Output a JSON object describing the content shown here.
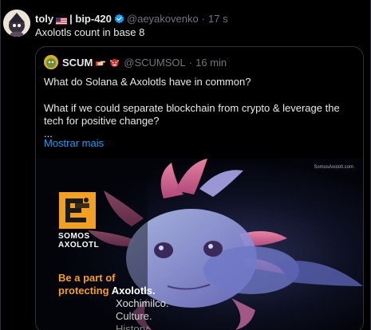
{
  "tweet": {
    "author_name": "toly",
    "author_suffix": "| bip-420",
    "handle": "@aeyakovenko",
    "separator": "·",
    "time": "17 s",
    "text": "Axolotls count in base 8"
  },
  "quote": {
    "author_name": "SCUM",
    "handle": "@SCUMSOL",
    "separator": "·",
    "time": "16 min",
    "line1": "What do Solana & Axolotls have in common?",
    "line2": "What if we could separate blockchain from crypto & leverage the tech for positive change?",
    "line3": "...",
    "show_more": "Mostrar mais"
  },
  "media": {
    "site": "SomosAxolotl.com",
    "logo_line1": "SOMOS",
    "logo_line2": "AXOLOTL",
    "cta_line1": "Be a part of",
    "cta_line2_orange": "protecting",
    "cta_line2_white": "Axolotls.",
    "cta_line3": "Xochimilco.",
    "cta_line4": "Culture.",
    "cta_line5": "History."
  },
  "colors": {
    "background": "#000000",
    "text": "#e7e9ea",
    "muted": "#71767b",
    "link": "#1d9bf0",
    "verified": "#1d9bf0",
    "brand_orange": "#f2a024"
  },
  "icons": [
    "avatar",
    "us-flag-icon",
    "verified-badge-icon",
    "pointing-hand-icon",
    "ogre-icon",
    "somos-axolotl-logo"
  ]
}
